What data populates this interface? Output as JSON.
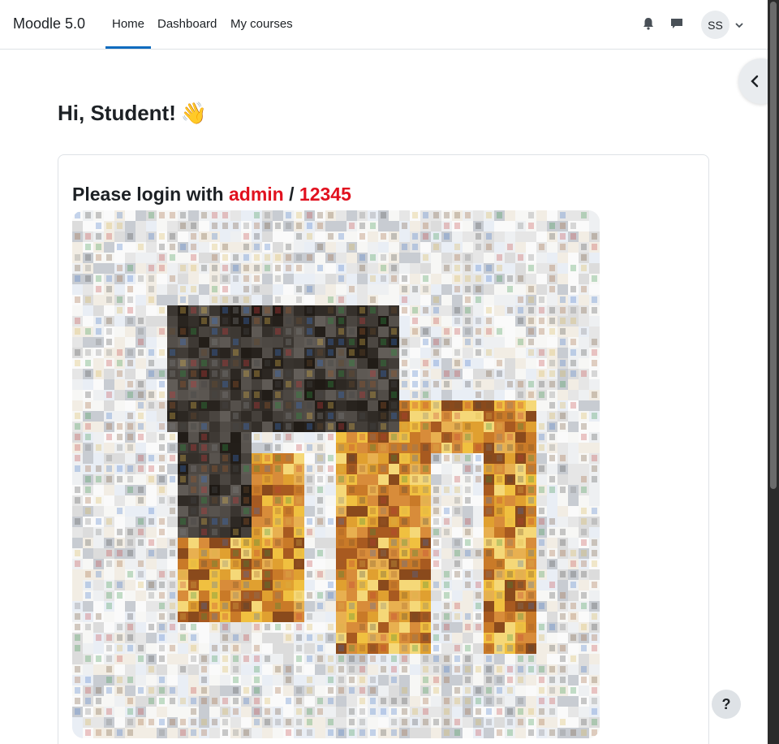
{
  "navbar": {
    "brand": "Moodle 5.0",
    "links": [
      "Home",
      "Dashboard",
      "My courses"
    ],
    "active_link": "Home",
    "icons": [
      "bell-icon",
      "message-icon",
      "chevron-down-icon"
    ],
    "user_initials": "SS"
  },
  "drawer": {
    "toggle_icon": "chevron-left-icon"
  },
  "main": {
    "greeting": "Hi, Student!",
    "greeting_emoji": "👋",
    "login_prefix": "Please login with",
    "login_user": "admin",
    "login_separator": "/",
    "login_password": "12345",
    "image_description_icon": "photo-mosaic-image"
  },
  "help": {
    "label": "?"
  },
  "colors": {
    "accent": "#0f6cbf",
    "highlight_red": "#e1111f",
    "text": "#1d2125",
    "border": "#dee2e6"
  }
}
